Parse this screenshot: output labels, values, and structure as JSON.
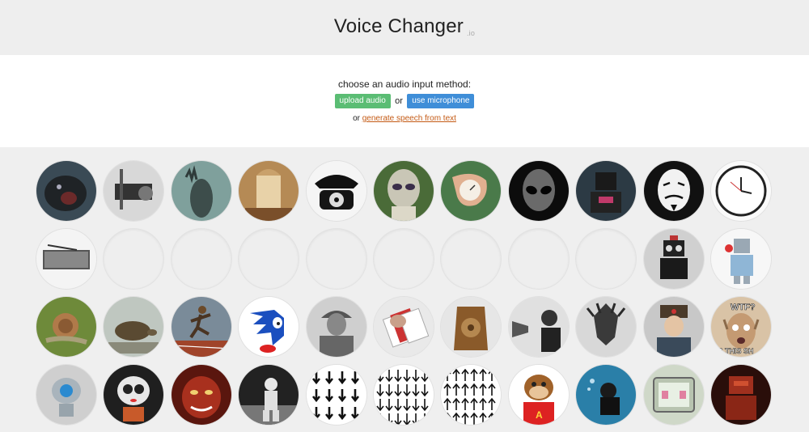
{
  "header": {
    "title": "Voice Changer",
    "subtitle": ".io"
  },
  "input": {
    "prompt": "choose an audio input method:",
    "upload_label": "upload audio",
    "or_label": "or",
    "mic_label": "use microphone",
    "or2_label": "or",
    "generate_label": "generate speech from text"
  },
  "voices": [
    {
      "icon": "gorilla-icon",
      "empty": false
    },
    {
      "icon": "old-radio-microphone-icon",
      "empty": false
    },
    {
      "icon": "ghost-hand-icon",
      "empty": false
    },
    {
      "icon": "cathedral-icon",
      "empty": false
    },
    {
      "icon": "rotary-phone-icon",
      "empty": false
    },
    {
      "icon": "alien-icon",
      "empty": false
    },
    {
      "icon": "melting-clock-icon",
      "empty": false
    },
    {
      "icon": "grey-alien-icon",
      "empty": false
    },
    {
      "icon": "dark-robot-icon",
      "empty": false
    },
    {
      "icon": "anonymous-mask-icon",
      "empty": false
    },
    {
      "icon": "backwards-clock-icon",
      "empty": false
    },
    {
      "icon": "vintage-radio-icon",
      "empty": false
    },
    {
      "icon": "empty-slot",
      "empty": true
    },
    {
      "icon": "empty-slot",
      "empty": true
    },
    {
      "icon": "empty-slot",
      "empty": true
    },
    {
      "icon": "empty-slot",
      "empty": true
    },
    {
      "icon": "empty-slot",
      "empty": true
    },
    {
      "icon": "empty-slot",
      "empty": true
    },
    {
      "icon": "empty-slot",
      "empty": true
    },
    {
      "icon": "empty-slot",
      "empty": true
    },
    {
      "icon": "toy-robot-icon",
      "empty": false
    },
    {
      "icon": "tin-robot-icon",
      "empty": false
    },
    {
      "icon": "snail-icon",
      "empty": false
    },
    {
      "icon": "tortoise-icon",
      "empty": false
    },
    {
      "icon": "sprinter-icon",
      "empty": false
    },
    {
      "icon": "sonic-hedgehog-icon",
      "empty": false
    },
    {
      "icon": "soldier-icon",
      "empty": false
    },
    {
      "icon": "playing-cards-icon",
      "empty": false
    },
    {
      "icon": "wooden-radio-icon",
      "empty": false
    },
    {
      "icon": "phonograph-man-icon",
      "empty": false
    },
    {
      "icon": "dark-knight-icon",
      "empty": false
    },
    {
      "icon": "soldier-hat-man-icon",
      "empty": false
    },
    {
      "icon": "wtf-face-icon",
      "empty": false
    },
    {
      "icon": "small-robot-icon",
      "empty": false
    },
    {
      "icon": "cute-robot-icon",
      "empty": false
    },
    {
      "icon": "demon-face-icon",
      "empty": false
    },
    {
      "icon": "astronaut-icon",
      "empty": false
    },
    {
      "icon": "arrows-down-icon",
      "empty": false
    },
    {
      "icon": "many-arrows-down-icon",
      "empty": false
    },
    {
      "icon": "many-arrows-up-icon",
      "empty": false
    },
    {
      "icon": "chipmunk-icon",
      "empty": false
    },
    {
      "icon": "scuba-diver-icon",
      "empty": false
    },
    {
      "icon": "tv-face-icon",
      "empty": false
    },
    {
      "icon": "red-robot-icon",
      "empty": false
    }
  ],
  "wtf_text": {
    "top": "WTF?",
    "bottom": "IS THIS SH"
  },
  "colors": {
    "upload_button": "#5bbd74",
    "mic_button": "#3f8ed8",
    "link": "#c45a14"
  }
}
